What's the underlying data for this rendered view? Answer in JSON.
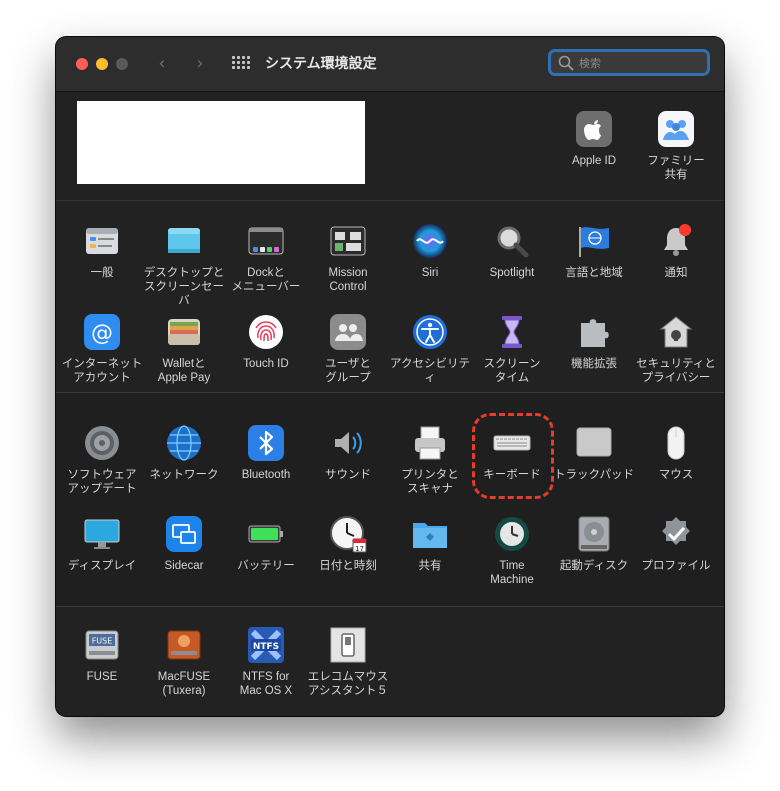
{
  "window": {
    "title": "システム環境設定"
  },
  "search": {
    "placeholder": "検索",
    "value": ""
  },
  "account_panes": [
    {
      "id": "apple-id",
      "label": "Apple ID",
      "icon": "apple-icon"
    },
    {
      "id": "family",
      "label": "ファミリー\n共有",
      "icon": "family-icon"
    }
  ],
  "row1": [
    {
      "id": "general",
      "label": "一般",
      "icon": "general-icon"
    },
    {
      "id": "desktop",
      "label": "デスクトップと\nスクリーンセーバ",
      "icon": "desktop-icon"
    },
    {
      "id": "dock",
      "label": "Dockと\nメニューバー",
      "icon": "dock-icon"
    },
    {
      "id": "mission-control",
      "label": "Mission\nControl",
      "icon": "mission-control-icon"
    },
    {
      "id": "siri",
      "label": "Siri",
      "icon": "siri-icon"
    },
    {
      "id": "spotlight",
      "label": "Spotlight",
      "icon": "spotlight-icon"
    },
    {
      "id": "language",
      "label": "言語と地域",
      "icon": "language-flag-icon"
    },
    {
      "id": "notifications",
      "label": "通知",
      "icon": "bell-icon"
    }
  ],
  "row2": [
    {
      "id": "internet-accounts",
      "label": "インターネット\nアカウント",
      "icon": "at-icon"
    },
    {
      "id": "wallet",
      "label": "Walletと\nApple Pay",
      "icon": "wallet-icon"
    },
    {
      "id": "touch-id",
      "label": "Touch ID",
      "icon": "fingerprint-icon"
    },
    {
      "id": "users",
      "label": "ユーザと\nグループ",
      "icon": "users-icon"
    },
    {
      "id": "accessibility",
      "label": "アクセシビリティ",
      "icon": "accessibility-icon"
    },
    {
      "id": "screen-time",
      "label": "スクリーン\nタイム",
      "icon": "hourglass-icon"
    },
    {
      "id": "extensions",
      "label": "機能拡張",
      "icon": "puzzle-icon"
    },
    {
      "id": "security",
      "label": "セキュリティと\nプライバシー",
      "icon": "house-lock-icon"
    }
  ],
  "row3": [
    {
      "id": "software-update",
      "label": "ソフトウェア\nアップデート",
      "icon": "gear-icon"
    },
    {
      "id": "network",
      "label": "ネットワーク",
      "icon": "globe-icon"
    },
    {
      "id": "bluetooth",
      "label": "Bluetooth",
      "icon": "bluetooth-icon"
    },
    {
      "id": "sound",
      "label": "サウンド",
      "icon": "speaker-icon"
    },
    {
      "id": "printers",
      "label": "プリンタと\nスキャナ",
      "icon": "printer-icon"
    },
    {
      "id": "keyboard",
      "label": "キーボード",
      "icon": "keyboard-icon"
    },
    {
      "id": "trackpad",
      "label": "トラックパッド",
      "icon": "trackpad-icon"
    },
    {
      "id": "mouse",
      "label": "マウス",
      "icon": "mouse-icon"
    }
  ],
  "row4": [
    {
      "id": "displays",
      "label": "ディスプレイ",
      "icon": "display-icon"
    },
    {
      "id": "sidecar",
      "label": "Sidecar",
      "icon": "sidecar-icon"
    },
    {
      "id": "battery",
      "label": "バッテリー",
      "icon": "battery-icon"
    },
    {
      "id": "date-time",
      "label": "日付と時刻",
      "icon": "clock-icon"
    },
    {
      "id": "sharing",
      "label": "共有",
      "icon": "folder-icon"
    },
    {
      "id": "time-machine",
      "label": "Time\nMachine",
      "icon": "time-machine-icon"
    },
    {
      "id": "startup-disk",
      "label": "起動ディスク",
      "icon": "disk-icon"
    },
    {
      "id": "profiles",
      "label": "プロファイル",
      "icon": "badge-check-icon"
    }
  ],
  "row5": [
    {
      "id": "fuse",
      "label": "FUSE",
      "icon": "fuse-drive-icon"
    },
    {
      "id": "macfuse",
      "label": "MacFUSE\n(Tuxera)",
      "icon": "macfuse-drive-icon"
    },
    {
      "id": "ntfs",
      "label": "NTFS for\nMac OS X",
      "icon": "ntfs-icon"
    },
    {
      "id": "elecom",
      "label": "エレコムマウス\nアシスタント５",
      "icon": "switch-icon"
    }
  ],
  "fuse_badge": "FUSE",
  "ntfs_badge": "NTFS",
  "colors": {
    "highlight": "#e53c2b",
    "search_focus": "#2f6fb4"
  }
}
